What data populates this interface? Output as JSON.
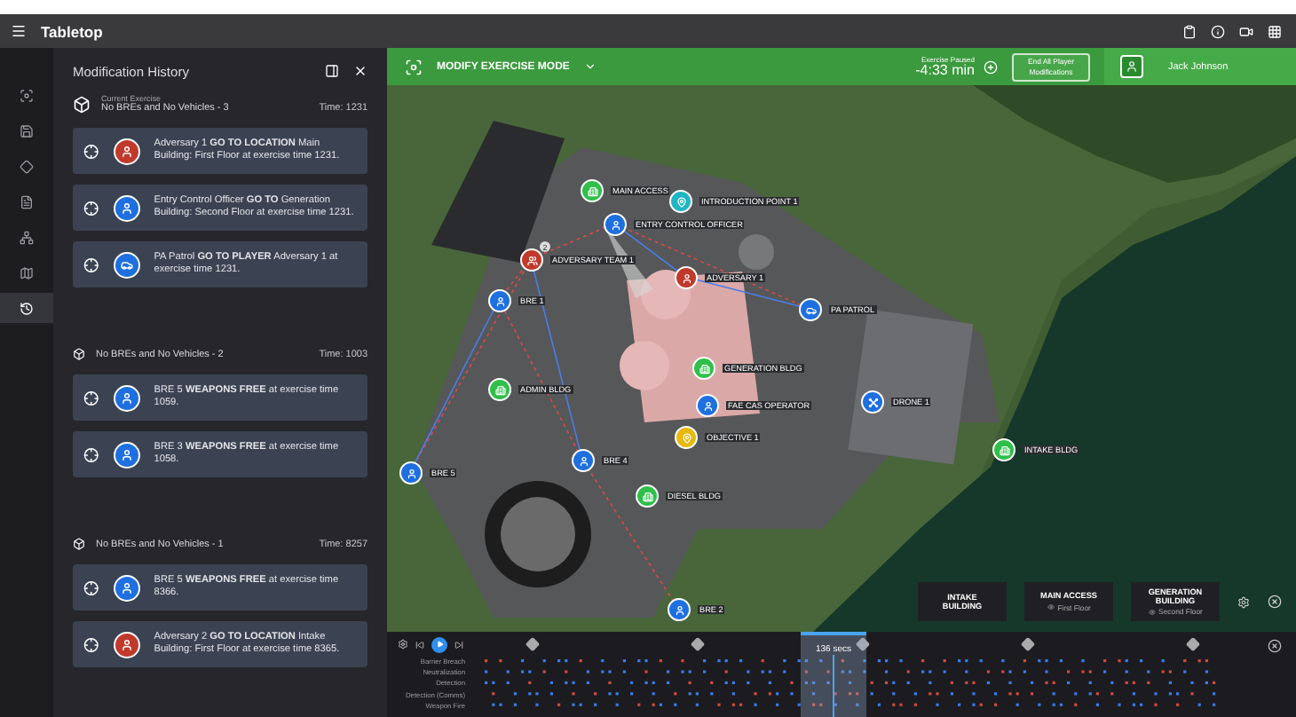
{
  "app_bar": {
    "title": "Tabletop"
  },
  "rail": [
    {
      "selected": false
    },
    {
      "selected": false
    },
    {
      "selected": false
    },
    {
      "selected": false
    },
    {
      "selected": false
    },
    {
      "selected": false
    },
    {
      "selected": true
    }
  ],
  "panel": {
    "title": "Modification History",
    "sections": [
      {
        "caption": "Current Exercise",
        "name": "No BREs and No Vehicles - 3",
        "time": "Time: 1231",
        "entries": [
          {
            "kind": "person",
            "color": "#c0392b",
            "text": "Adversary 1 **GO TO LOCATION** Main Building: First Floor at exercise time 1231."
          },
          {
            "kind": "person",
            "color": "#1e6fe0",
            "text": "Entry Control Officer **GO TO** Generation Building: Second Floor at exercise time 1231."
          },
          {
            "kind": "vehicle",
            "color": "#1e6fe0",
            "text": "PA Patrol **GO TO PLAYER** Adversary 1 at exercise time 1231."
          }
        ]
      },
      {
        "name": "No BREs and No Vehicles - 2",
        "time": "Time: 1003",
        "entries": [
          {
            "kind": "person",
            "color": "#1e6fe0",
            "text": "BRE 5 **WEAPONS FREE** at exercise time 1059."
          },
          {
            "kind": "person",
            "color": "#1e6fe0",
            "text": "BRE 3 **WEAPONS FREE** at exercise time 1058."
          }
        ]
      },
      {
        "name": "No BREs and No Vehicles - 1",
        "time": "Time: 8257",
        "entries": [
          {
            "kind": "person",
            "color": "#1e6fe0",
            "text": "BRE 5 **WEAPONS FREE** at exercise time 8366."
          },
          {
            "kind": "person",
            "color": "#c0392b",
            "text": "Adversary 2 **GO TO LOCATION** Intake Building: First Floor at exercise time 8365."
          }
        ]
      }
    ]
  },
  "mode_bar": {
    "mode": "MODIFY EXERCISE MODE",
    "status": "Exercise Paused",
    "clock": "-4:33 min",
    "end_button": "End All Player Modifications",
    "user": "Jack Johnson"
  },
  "map": {
    "markers": [
      {
        "label": "MAIN ACCESS",
        "kind": "building",
        "color": "#2fbf4a"
      },
      {
        "label": "INTRODUCTION POINT 1",
        "kind": "pin",
        "color": "#1fb5c4"
      },
      {
        "label": "ENTRY CONTROL OFFICER",
        "kind": "person",
        "color": "#1e6fe0"
      },
      {
        "label": "ADVERSARY TEAM 1",
        "kind": "team",
        "color": "#c0392b",
        "count": "2"
      },
      {
        "label": "ADVERSARY 1",
        "kind": "person",
        "color": "#c0392b"
      },
      {
        "label": "BRE 1",
        "kind": "person",
        "color": "#1e6fe0"
      },
      {
        "label": "PA PATROL",
        "kind": "vehicle",
        "color": "#1e6fe0"
      },
      {
        "label": "GENERATION BLDG",
        "kind": "building",
        "color": "#2fbf4a"
      },
      {
        "label": "ADMIN BLDG",
        "kind": "building",
        "color": "#2fbf4a"
      },
      {
        "label": "FAE CAS OPERATOR",
        "kind": "person",
        "color": "#1e6fe0"
      },
      {
        "label": "DRONE 1",
        "kind": "drone",
        "color": "#1e6fe0"
      },
      {
        "label": "OBJECTIVE 1",
        "kind": "pin",
        "color": "#e8b80c"
      },
      {
        "label": "INTAKE BLDG",
        "kind": "building",
        "color": "#2fbf4a"
      },
      {
        "label": "BRE 5",
        "kind": "person",
        "color": "#1e6fe0"
      },
      {
        "label": "BRE 4",
        "kind": "person",
        "color": "#1e6fe0"
      },
      {
        "label": "DIESEL BLDG",
        "kind": "building",
        "color": "#2fbf4a"
      },
      {
        "label": "BRE 2",
        "kind": "person",
        "color": "#1e6fe0"
      }
    ],
    "locations": [
      {
        "name": "INTAKE BUILDING"
      },
      {
        "name": "MAIN ACCESS",
        "floor": "First Floor"
      },
      {
        "name": "GENERATION BUILDING",
        "floor": "Second Floor"
      }
    ]
  },
  "timeline": {
    "rows": [
      "Barrier Breach",
      "Neutralization",
      "Detection",
      "Detection (Comms)",
      "Weapon Fire"
    ],
    "window_label": "136 secs"
  }
}
